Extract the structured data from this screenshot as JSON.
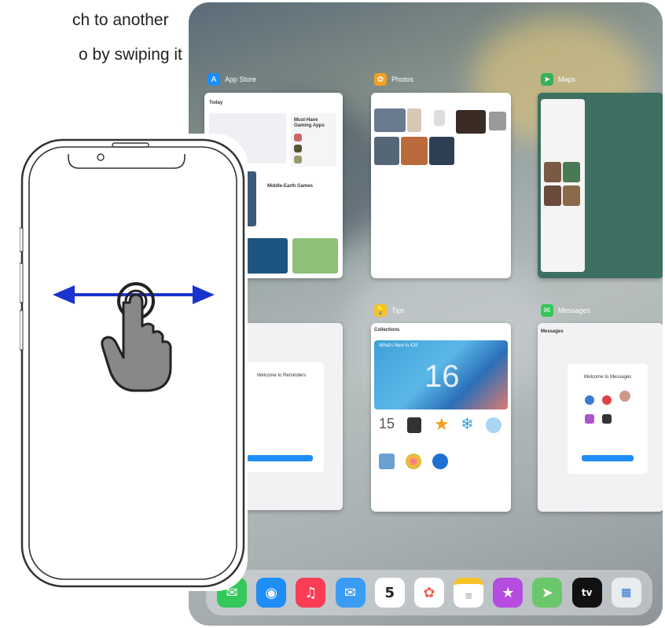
{
  "caption": {
    "line1": "ch to another",
    "line2": "o by swiping it"
  },
  "ipad": {
    "apps": [
      {
        "name": "App Store",
        "icon": "app-store-icon",
        "color": "#1e8df5"
      },
      {
        "name": "Photos",
        "icon": "photos-icon",
        "color": "#f4a020"
      },
      {
        "name": "Maps",
        "icon": "maps-icon",
        "color": "#38b05a"
      },
      {
        "name": "Tips",
        "icon": "tips-icon",
        "color": "#f6c22a"
      },
      {
        "name": "Messages",
        "icon": "messages-icon",
        "color": "#34c759"
      }
    ],
    "app_store_card": {
      "heading": "Today",
      "list_title": "Must-Have Gaming Apps",
      "banner": "Middle-Earth Games"
    },
    "tips_card": {
      "heading": "Collections",
      "banner_subtitle": "What's New in iOS",
      "big_number": "16",
      "row_number": "15"
    },
    "messages_card": {
      "heading": "Messages",
      "dialog_title": "Welcome to Messages"
    },
    "reminders_card": {
      "dialog_title": "Welcome to Reminders"
    },
    "dock": {
      "calendar_day": "5",
      "tv_label": "tv",
      "icons": [
        "messages-icon",
        "safari-icon",
        "music-icon",
        "mail-icon",
        "calendar-icon",
        "photos-icon",
        "notes-icon",
        "itunes-store-icon",
        "maps-icon",
        "apple-tv-icon",
        "more-apps-icon"
      ]
    }
  },
  "colors": {
    "arrow": "#1a33cc",
    "hand": "#888888"
  }
}
